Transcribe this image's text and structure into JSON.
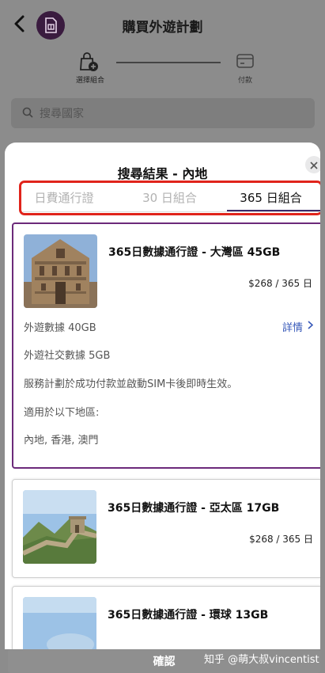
{
  "header": {
    "title": "購買外遊計劃",
    "back_icon": "chevron-left-icon",
    "app_icon": "sim-card-icon"
  },
  "stepper": {
    "steps": [
      {
        "label": "選擇組合",
        "icon": "bag-add-icon",
        "active": true
      },
      {
        "label": "付款",
        "icon": "card-icon",
        "active": false
      }
    ]
  },
  "search": {
    "placeholder": "搜尋國家",
    "icon": "search-icon"
  },
  "sheet": {
    "title": "搜尋結果 - 內地",
    "close_icon": "close-icon",
    "tabs": [
      {
        "label": "日費通行證",
        "selected": false
      },
      {
        "label": "30 日組合",
        "selected": false
      },
      {
        "label": "365 日組合",
        "selected": true
      }
    ],
    "highlight_color": "#e0241b"
  },
  "plans": [
    {
      "name": "365日數據通行證 - 大灣區 45GB",
      "price": "$268 / 365 日",
      "selected": true,
      "detail_label": "詳情",
      "info": {
        "data": "外遊數據 40GB",
        "social": "外遊社交數據 5GB",
        "activation": "服務計劃於成功付款並啟動SIM卡後即時生效。",
        "regions_title": "適用於以下地區:",
        "regions": "內地, 香港, 澳門"
      }
    },
    {
      "name": "365日數據通行證 - 亞太區 17GB",
      "price": "$268 / 365 日",
      "selected": false
    },
    {
      "name": "365日數據通行證 - 環球 13GB",
      "selected": false
    }
  ],
  "footer": {
    "confirm_label": "確認",
    "watermark": "知乎 @萌大叔vincentist"
  },
  "colors": {
    "accent_purple": "#6c2a7a",
    "link_blue": "#3557b8"
  }
}
